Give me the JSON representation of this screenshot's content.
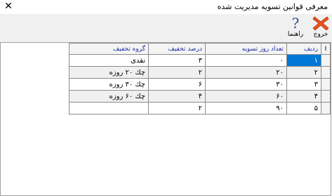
{
  "window": {
    "title": "معرفی قوانین تسویه مدیریت شده",
    "close_glyph": "✕"
  },
  "toolbar": {
    "exit_label": "خروج",
    "help_label": "راهنما",
    "help_glyph": "?"
  },
  "grid": {
    "headers": {
      "indicator": "I",
      "row": "ردیف",
      "days": "تعداد روز تسویه",
      "discount_percent": "درصد تخفیف",
      "discount_group": "گروه تخفیف"
    },
    "rows": [
      {
        "row": "۱",
        "days": "۰",
        "discount_percent": "۳",
        "discount_group": "نقدی"
      },
      {
        "row": "۲",
        "days": "۲۰",
        "discount_percent": "۲",
        "discount_group": "چك ۲۰ روزه"
      },
      {
        "row": "۳",
        "days": "۳۰",
        "discount_percent": "۶",
        "discount_group": "چك ۳۰ روزه"
      },
      {
        "row": "۴",
        "days": "۶۰",
        "discount_percent": "۴",
        "discount_group": "چك ۶۰ روزه"
      },
      {
        "row": "۵",
        "days": "۹۰",
        "discount_percent": "۲",
        "discount_group": ""
      }
    ]
  },
  "colors": {
    "selection": "#0078d7",
    "header_text": "#1c2ea8",
    "exit_icon": "#e8531f",
    "help_icon": "#3a4a9a"
  }
}
